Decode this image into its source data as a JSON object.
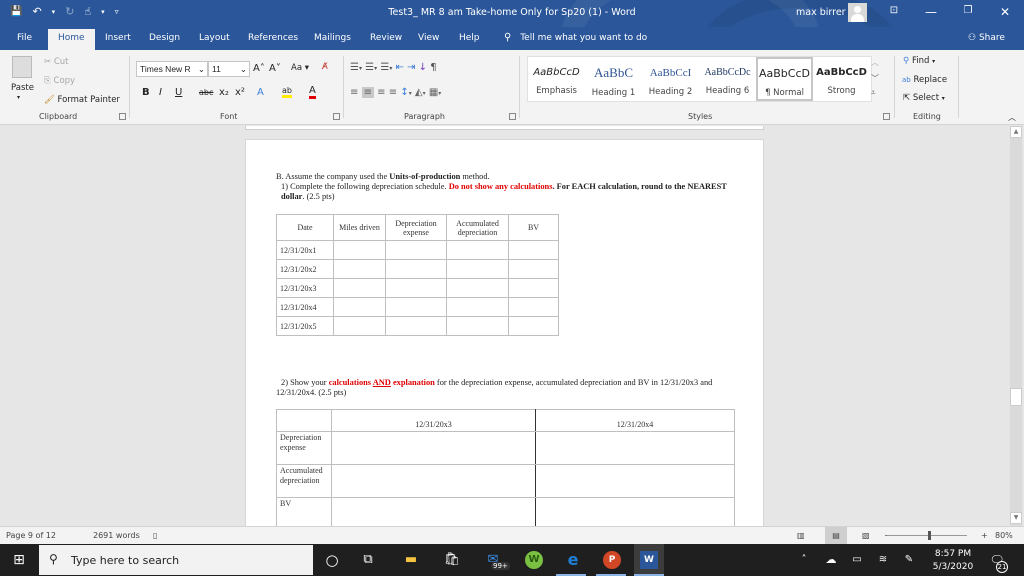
{
  "titlebar": {
    "title": "Test3_ MR 8 am Take-home Only for Sp20 (1)  -  Word",
    "user": "max birrer",
    "qat": {
      "save": "💾",
      "undo": "↶",
      "undo_dd": "▾",
      "redo": "↻",
      "touch": "☝",
      "touch_dd": "▾",
      "customize": "▿"
    },
    "window": {
      "ribbon_display": "⊡",
      "minimize": "—",
      "restore": "❐",
      "close": "✕"
    }
  },
  "tabs": [
    "File",
    "Home",
    "Insert",
    "Design",
    "Layout",
    "References",
    "Mailings",
    "Review",
    "View",
    "Help"
  ],
  "tellme": "Tell me what you want to do",
  "share": "Share",
  "ribbon": {
    "clipboard": {
      "label": "Clipboard",
      "paste": "Paste",
      "cut": "Cut",
      "copy": "Copy",
      "format_painter": "Format Painter"
    },
    "font": {
      "label": "Font",
      "name": "Times New R",
      "size": "11",
      "grow": "A˄",
      "shrink": "A˅",
      "case": "Aa ▾",
      "bold": "B",
      "italic": "I",
      "underline": "U",
      "strike": "abc",
      "sub": "x₂",
      "sup": "x²",
      "effects": "A",
      "highlight": "ab",
      "color": "A"
    },
    "paragraph": {
      "label": "Paragraph"
    },
    "styles": {
      "label": "Styles",
      "items": [
        {
          "preview": "AaBbCcD",
          "name": "Emphasis"
        },
        {
          "preview": "AaBbC",
          "name": "Heading 1"
        },
        {
          "preview": "AaBbCcI",
          "name": "Heading 2"
        },
        {
          "preview": "AaBbCcDc",
          "name": "Heading 6"
        },
        {
          "preview": "AaBbCcD",
          "name": "¶ Normal"
        },
        {
          "preview": "AaBbCcD",
          "name": "Strong"
        }
      ]
    },
    "editing": {
      "label": "Editing",
      "find": "Find",
      "replace": "Replace",
      "select": "Select"
    }
  },
  "document": {
    "intro": {
      "p1_a": "B. Assume the company used the ",
      "p1_b": "Units-of-production",
      "p1_c": " method.",
      "p2_a": "1) Complete the following depreciation schedule. ",
      "p2_red": "Do not show any calculations",
      "p2_b": ". For EACH calculation, round to the NEAREST dollar",
      "p2_c": ". (2.5 pts)"
    },
    "schedule": {
      "headers": [
        "Date",
        "Miles driven",
        "Depreciation expense",
        "Accumulated depreciation",
        "BV"
      ],
      "rows": [
        "12/31/20x1",
        "12/31/20x2",
        "12/31/20x3",
        "12/31/20x4",
        "12/31/20x5"
      ]
    },
    "q2": {
      "a": "2) Show your ",
      "red1": "calculations ",
      "and": "AND",
      "red2": " explanation",
      "b": " for the depreciation expense, accumulated depreciation and BV in 12/31/20x3 and 12/31/20x4. (2.5 pts)"
    },
    "calc": {
      "headers": [
        "",
        "12/31/20x3",
        "12/31/20x4"
      ],
      "rows": [
        "Depreciation expense",
        "Accumulated depreciation",
        "BV"
      ]
    }
  },
  "status": {
    "page": "Page 9 of 12",
    "words": "2691 words",
    "zoom": "80%",
    "zoom_value": 80
  },
  "taskbar": {
    "search_placeholder": "Type here to search",
    "mail_badge": "99+",
    "time": "8:57 PM",
    "date": "5/3/2020",
    "notifications": "21"
  }
}
